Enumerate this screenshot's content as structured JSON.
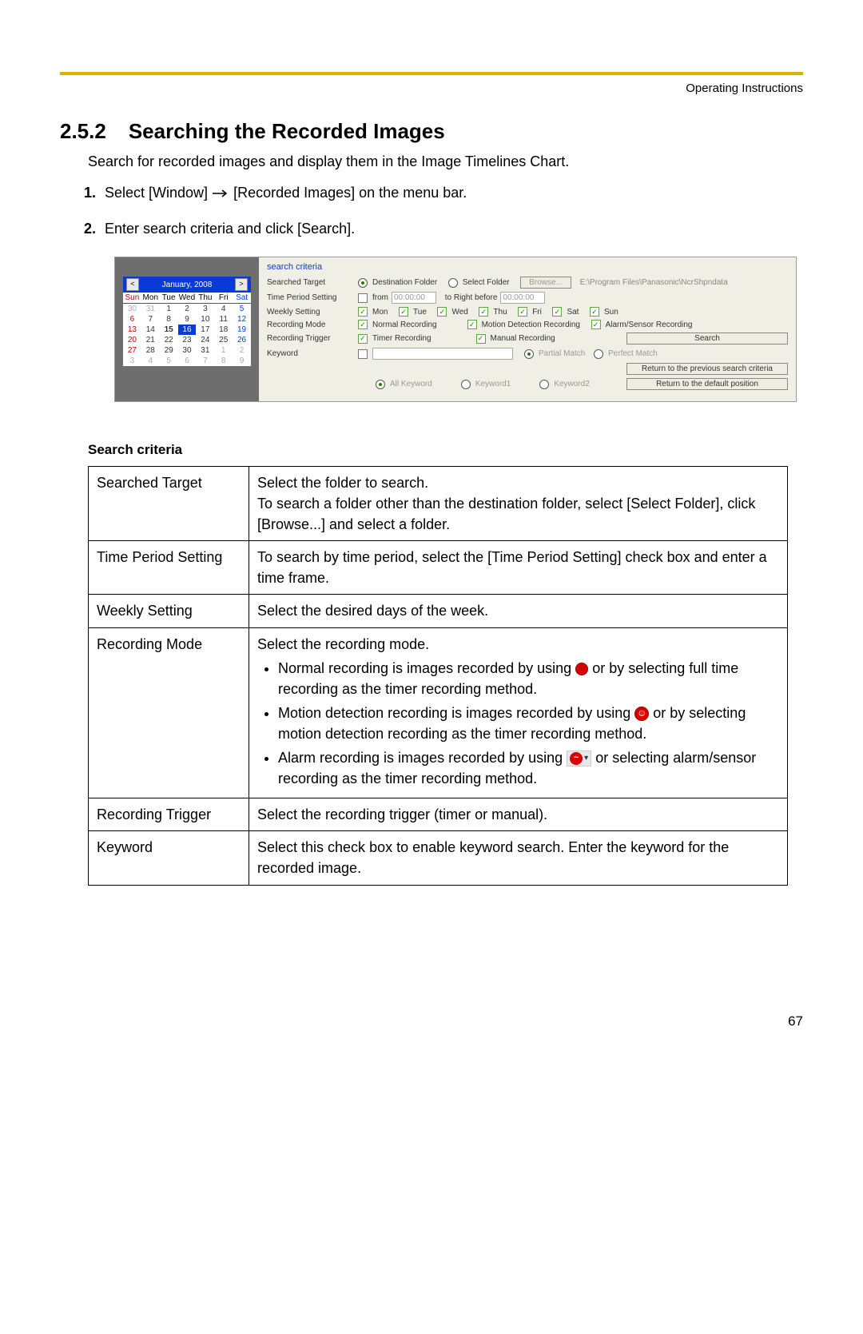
{
  "header": {
    "doc_title": "Operating Instructions"
  },
  "section": {
    "number": "2.5.2",
    "title": "Searching the Recorded Images",
    "intro": "Search for recorded images and display them in the Image Timelines Chart."
  },
  "steps": {
    "s1a": "Select [Window] ",
    "s1b": " [Recorded Images] on the menu bar.",
    "s2": "Enter search criteria and click [Search]."
  },
  "shot": {
    "sc_title": "search criteria",
    "cal_month": "January, 2008",
    "days": {
      "sun": "Sun",
      "mon": "Mon",
      "tue": "Tue",
      "wed": "Wed",
      "thu": "Thu",
      "fri": "Fri",
      "sat": "Sat"
    },
    "lbl_target": "Searched Target",
    "opt_dest": "Destination Folder",
    "opt_select": "Select Folder",
    "btn_browse": "Browse...",
    "path": "E:\\Program Files\\Panasonic\\NcrShpndata",
    "lbl_time": "Time Period Setting",
    "from": "from",
    "time_from": "00:00:00",
    "to": "to  Right before",
    "time_to": "00:00:00",
    "lbl_week": "Weekly Setting",
    "wk": {
      "mon": "Mon",
      "tue": "Tue",
      "wed": "Wed",
      "thu": "Thu",
      "fri": "Fri",
      "sat": "Sat",
      "sun": "Sun"
    },
    "lbl_mode": "Recording Mode",
    "mode_normal": "Normal Recording",
    "mode_motion": "Motion Detection Recording",
    "mode_alarm": "Alarm/Sensor Recording",
    "lbl_trigger": "Recording Trigger",
    "trig_timer": "Timer Recording",
    "trig_manual": "Manual Recording",
    "btn_search": "Search",
    "btn_return_prev": "Return to the previous search  criteria",
    "btn_return_def": "Return to the default position",
    "lbl_keyword": "Keyword",
    "kw_partial": "Partial Match",
    "kw_perfect": "Perfect Match",
    "kw_all": "All Keyword",
    "kw1": "Keyword1",
    "kw2": "Keyword2"
  },
  "table": {
    "heading": "Search criteria",
    "rows": {
      "target_l": "Searched Target",
      "target_r": "Select the folder to search.\nTo search a folder other than the destination folder, select [Select Folder], click [Browse...] and select a folder.",
      "time_l": "Time Period Setting",
      "time_r": "To search by time period, select the [Time Period Setting] check box and enter a time frame.",
      "week_l": "Weekly Setting",
      "week_r": "Select the desired days of the week.",
      "mode_l": "Recording Mode",
      "mode_r_intro": "Select the recording mode.",
      "mode_b1a": "Normal recording is images recorded by using ",
      "mode_b1b": " or by selecting full time recording as the timer recording method.",
      "mode_b2a": "Motion detection recording is images recorded by using ",
      "mode_b2b": " or by selecting motion detection recording as the timer recording method.",
      "mode_b3a": "Alarm recording is images recorded by using ",
      "mode_b3b": " or selecting alarm/sensor recording as the timer recording method.",
      "trig_l": "Recording Trigger",
      "trig_r": "Select the recording trigger (timer or manual).",
      "kw_l": "Keyword",
      "kw_r": "Select this check box to enable keyword search. Enter the keyword for the recorded image."
    }
  },
  "page_number": "67"
}
